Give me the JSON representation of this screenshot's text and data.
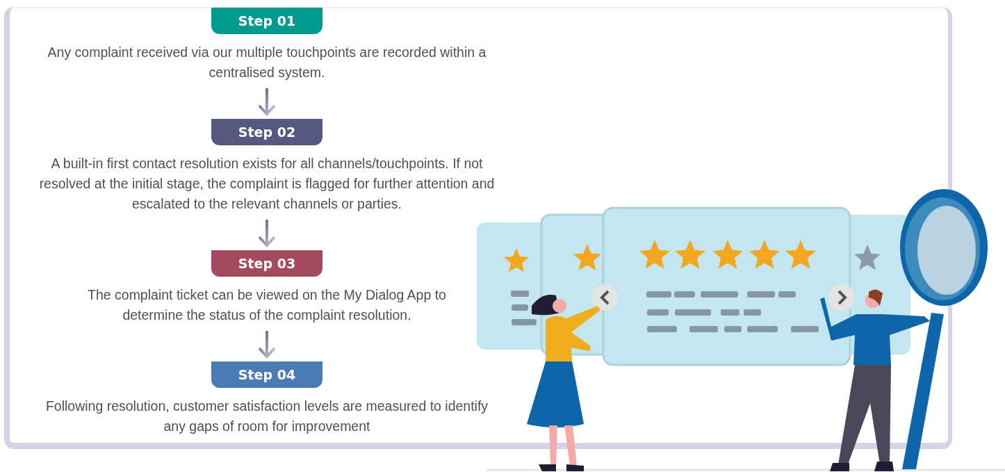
{
  "steps": [
    {
      "label": "Step 01",
      "color": "#009b8e",
      "text": "Any complaint received via our multiple touchpoints are recorded within a centralised system."
    },
    {
      "label": "Step 02",
      "color": "#55577f",
      "text": "A built-in first contact resolution exists for all channels/touchpoints. If not resolved at the initial stage, the complaint is flagged for further attention and escalated to the relevant channels or parties."
    },
    {
      "label": "Step 03",
      "color": "#a34a5e",
      "text": "The complaint ticket can be viewed on the My Dialog App to determine the status of the complaint resolution."
    },
    {
      "label": "Step 04",
      "color": "#4b7bb5",
      "text": "Following resolution, customer satisfaction levels are measured to identify any gaps of room for improvement"
    }
  ]
}
